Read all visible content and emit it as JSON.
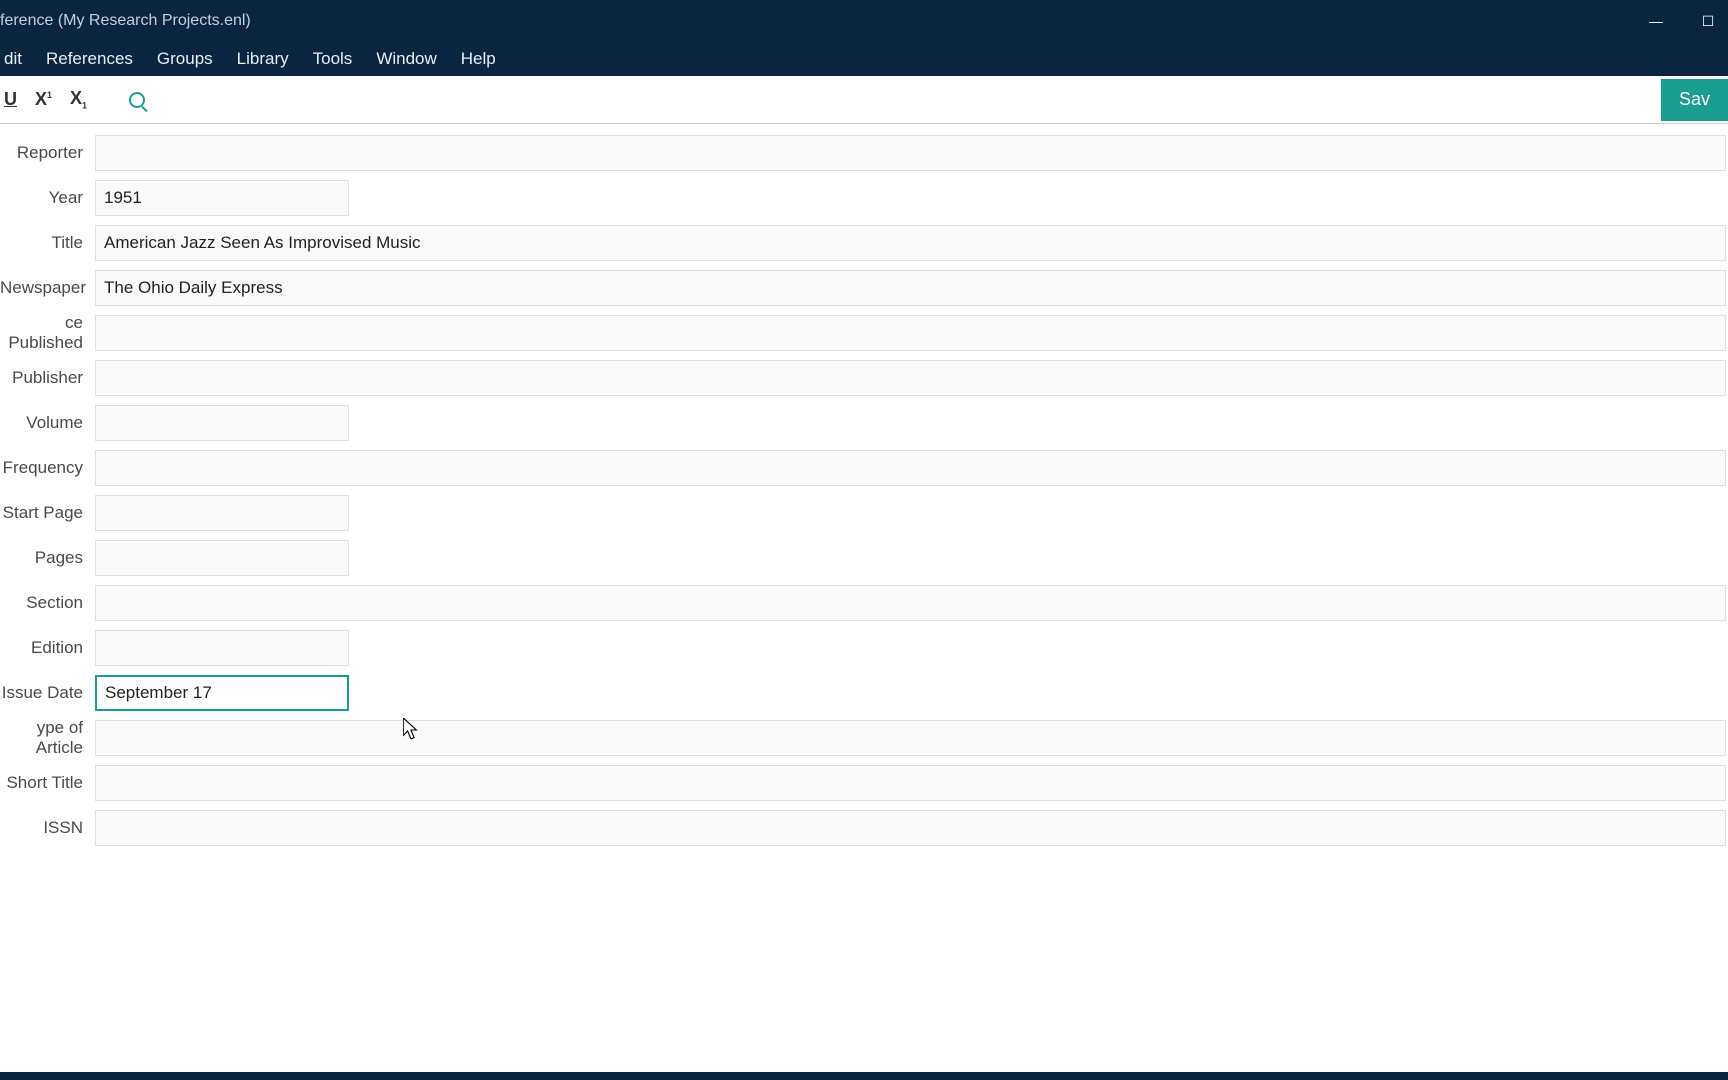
{
  "window": {
    "title": "ference (My Research Projects.enl)"
  },
  "menu": {
    "items": [
      "dit",
      "References",
      "Groups",
      "Library",
      "Tools",
      "Window",
      "Help"
    ]
  },
  "toolbar": {
    "underline": "U",
    "superscript": "X",
    "subscript": "X",
    "save_label": "Sav"
  },
  "fields": {
    "reporter": {
      "label": "Reporter",
      "value": "",
      "width": "full"
    },
    "year": {
      "label": "Year",
      "value": "1951",
      "width": "short"
    },
    "title": {
      "label": "Title",
      "value": "American Jazz Seen As Improvised Music",
      "width": "full"
    },
    "newspaper": {
      "label": "Newspaper",
      "value": "The Ohio Daily Express",
      "width": "full"
    },
    "place_published": {
      "label": "ce Published",
      "value": "",
      "width": "full"
    },
    "publisher": {
      "label": "Publisher",
      "value": "",
      "width": "full"
    },
    "volume": {
      "label": "Volume",
      "value": "",
      "width": "short"
    },
    "frequency": {
      "label": "Frequency",
      "value": "",
      "width": "full"
    },
    "start_page": {
      "label": "Start Page",
      "value": "",
      "width": "short"
    },
    "pages": {
      "label": "Pages",
      "value": "",
      "width": "short"
    },
    "section": {
      "label": "Section",
      "value": "",
      "width": "full"
    },
    "edition": {
      "label": "Edition",
      "value": "",
      "width": "short"
    },
    "issue_date": {
      "label": "Issue Date",
      "value": "September 17",
      "width": "short",
      "focused": true
    },
    "type_of_article": {
      "label": "ype of Article",
      "value": "",
      "width": "full"
    },
    "short_title": {
      "label": "Short Title",
      "value": "",
      "width": "full"
    },
    "issn": {
      "label": "ISSN",
      "value": "",
      "width": "full"
    }
  }
}
